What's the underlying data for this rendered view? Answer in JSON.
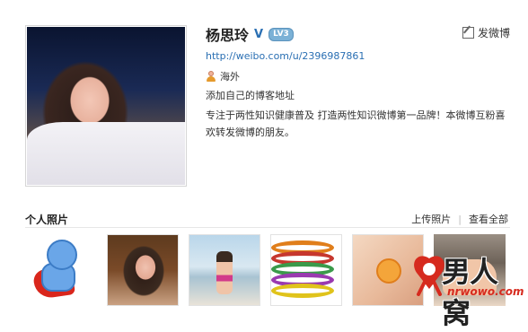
{
  "profile": {
    "name": "杨思玲",
    "verified_mark": "V",
    "level_badge": "LV3",
    "post_button_label": "发微博",
    "url": "http://weibo.com/u/2396987861",
    "location": "海外",
    "blog_link": "添加自己的博客地址",
    "bio": "专注于两性知识健康普及 打造两性知识微博第一品牌！本微博互粉喜欢转发微博的朋友。"
  },
  "photos": {
    "title": "个人照片",
    "upload_label": "上传照片",
    "separator": "|",
    "view_all_label": "查看全部",
    "items": [
      "photo-1",
      "photo-2",
      "photo-3",
      "photo-4",
      "photo-5",
      "photo-6"
    ]
  },
  "watermark": {
    "brand": "男人窝",
    "domain": "nrwowo.com"
  },
  "colors": {
    "link": "#2a6fb3",
    "accent_red": "#d62a1e",
    "badge": "#7bb1d6"
  }
}
